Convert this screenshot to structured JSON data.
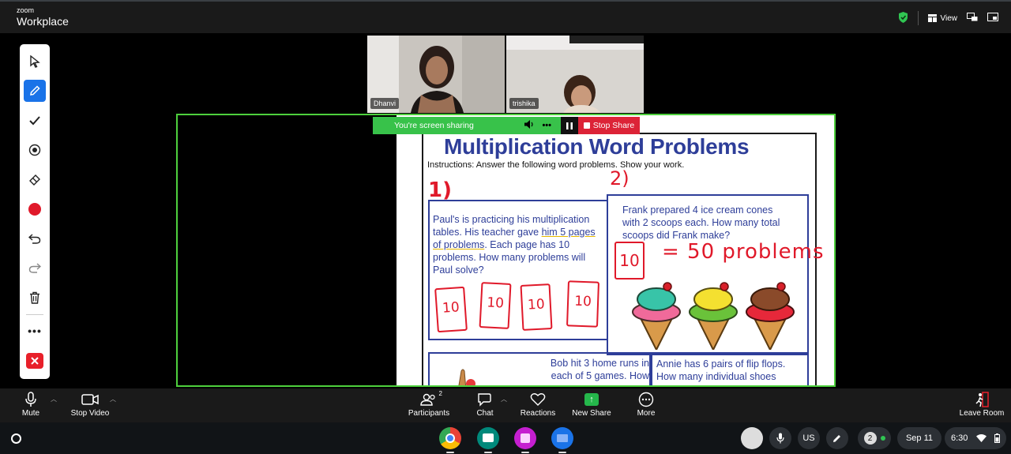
{
  "app": {
    "brand_small": "zoom",
    "brand_big": "Workplace",
    "view_label": "View"
  },
  "participants": [
    {
      "name": "Dhanvi"
    },
    {
      "name": "trishika"
    }
  ],
  "share_bar": {
    "status": "You're screen sharing",
    "stop_label": "Stop Share"
  },
  "worksheet": {
    "title": "Multiplication Word Problems",
    "instructions": "Instructions: Answer the following word problems. Show your work.",
    "problem1_pre": "Paul's is practicing his multiplication tables.  His teacher gave ",
    "problem1_ul": "him 5 pages of problems",
    "problem1_post": ".  Each page has 10 problems.  How many problems will Paul solve?",
    "problem2": "Frank prepared 4 ice cream cones with 2 scoops each.  How many total scoops did Frank make?",
    "problem3": "Bob hit 3 home runs in each of 5 games.  How",
    "problem4": "Annie has 6 pairs of flip flops. How many individual shoes",
    "annotation_num1": "1)",
    "annotation_num2": "2)",
    "annotation_boxes": [
      "10",
      "10",
      "10",
      "10"
    ],
    "annotation_answer_box": "10",
    "annotation_answer": "= 50 problems"
  },
  "controls": {
    "mute": "Mute",
    "stop_video": "Stop Video",
    "participants": "Participants",
    "participants_count": "2",
    "chat": "Chat",
    "reactions": "Reactions",
    "new_share": "New Share",
    "more": "More",
    "leave": "Leave Room"
  },
  "shelf": {
    "keyboard": "US",
    "notif_count": "2",
    "date": "Sep 11",
    "time": "6:30"
  },
  "colors": {
    "share_green": "#38c24a",
    "stop_red": "#dc2337",
    "title_blue": "#2e3e99",
    "ink_red": "#e0192a"
  }
}
